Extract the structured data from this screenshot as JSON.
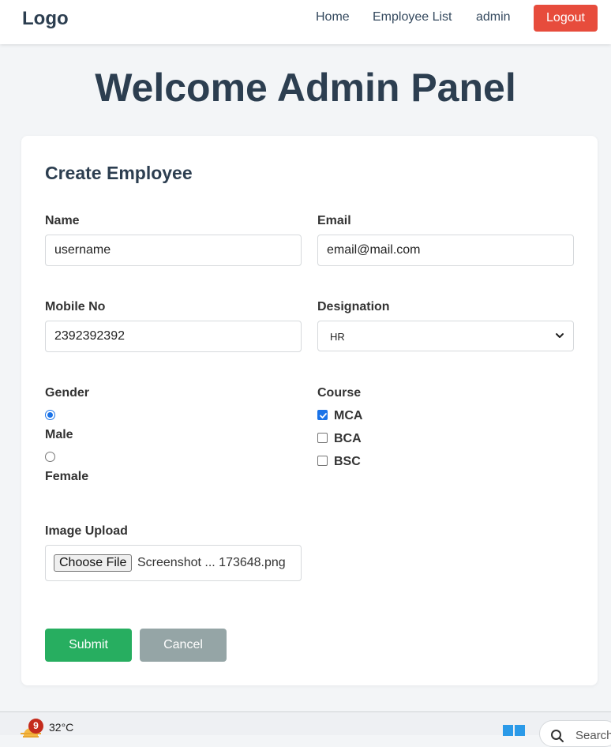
{
  "nav": {
    "logo": "Logo",
    "links": [
      "Home",
      "Employee List",
      "admin"
    ],
    "logout": "Logout"
  },
  "page": {
    "title": "Welcome Admin Panel"
  },
  "form": {
    "title": "Create Employee",
    "name": {
      "label": "Name",
      "value": "username"
    },
    "email": {
      "label": "Email",
      "value": "email@mail.com"
    },
    "mobile": {
      "label": "Mobile No",
      "value": "2392392392"
    },
    "designation": {
      "label": "Designation",
      "selected": "HR"
    },
    "gender": {
      "label": "Gender",
      "options": [
        "Male",
        "Female"
      ],
      "selected": "Male"
    },
    "course": {
      "label": "Course",
      "options": [
        "MCA",
        "BCA",
        "BSC"
      ],
      "checked": [
        "MCA"
      ]
    },
    "image": {
      "label": "Image Upload",
      "button": "Choose File",
      "file_name": "Screenshot ... 173648.png"
    },
    "submit": "Submit",
    "cancel": "Cancel"
  },
  "taskbar": {
    "notification_count": "9",
    "temperature": "32°C",
    "search_placeholder": "Search"
  },
  "colors": {
    "logout": "#e74c3c",
    "submit": "#27ae60",
    "cancel": "#95a5a6",
    "heading": "#2c3e50",
    "accent": "#1a73e8"
  }
}
